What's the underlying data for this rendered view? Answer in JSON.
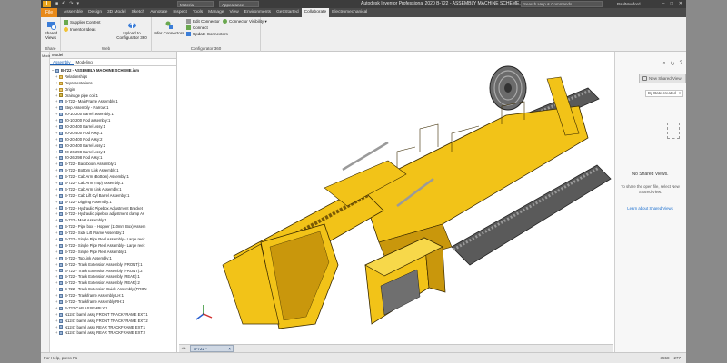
{
  "titlebar": {
    "logo": "I",
    "qat_items": [
      "■",
      "↶",
      "↷",
      "▾"
    ],
    "material": "Material",
    "appearance": "Appearance",
    "title": "Autodesk Inventor Professional 2020   B-722 - ASSEMBLY MACHINE SCHEME.iam",
    "search_placeholder": "Search Help & Commands...",
    "user": "PaulMunford",
    "window_buttons": [
      "−",
      "□",
      "✕"
    ]
  },
  "menubar": {
    "file_label": "File",
    "tabs": [
      {
        "label": "Assemble"
      },
      {
        "label": "Design"
      },
      {
        "label": "3D Model"
      },
      {
        "label": "Sketch"
      },
      {
        "label": "Annotate"
      },
      {
        "label": "Inspect"
      },
      {
        "label": "Tools"
      },
      {
        "label": "Manage"
      },
      {
        "label": "View"
      },
      {
        "label": "Environments"
      },
      {
        "label": "Get Started"
      },
      {
        "label": "Collaborate"
      },
      {
        "label": "Electromechanical"
      }
    ]
  },
  "ribbon": {
    "shared_views": "Shared Views",
    "share_group": "Share",
    "supplier_content": "Supplier Content",
    "inventor_ideas": "Inventor Ideas",
    "web_group": "Web",
    "upload": "Upload to Configurator 360",
    "infer_connectors": "Infer Connectors",
    "edit_connector": "Edit Connector",
    "connect": "Connect",
    "update_connectors": "Update Connectors",
    "connector_visibility": "Connector Visibility",
    "configurator_group": "Configurator 360"
  },
  "browser": {
    "header": "Model",
    "tabs": [
      "Assembly",
      "Modeling"
    ],
    "nodes": [
      {
        "label": "B-722 - ASSEMBLY MACHINE SCHEME.iam",
        "type": "asm"
      },
      {
        "label": "Relationships",
        "type": "folder"
      },
      {
        "label": "Representations",
        "type": "folder"
      },
      {
        "label": "Origin",
        "type": "folder"
      },
      {
        "label": "Drainage pipe coil:1",
        "type": "part"
      },
      {
        "label": "B-722 - MainFrame Assembly:1",
        "type": "asm"
      },
      {
        "label": "Step Assembly - Narrow:1",
        "type": "asm"
      },
      {
        "label": "20-10-200 Barrel assembly:1",
        "type": "asm"
      },
      {
        "label": "20-10-200 Rod assembly:1",
        "type": "asm"
      },
      {
        "label": "20-20-400 Barrel Assy:1",
        "type": "asm"
      },
      {
        "label": "20-20-400 Rod Assy:1",
        "type": "asm"
      },
      {
        "label": "20-20-400 Rod Assy:2",
        "type": "asm"
      },
      {
        "label": "20-20-400 Barrel Assy:2",
        "type": "asm"
      },
      {
        "label": "20-26-298 Barrel Assy:1",
        "type": "asm"
      },
      {
        "label": "20-26-298 Rod Assy:1",
        "type": "asm"
      },
      {
        "label": "B-722 - Backboom Assembly:1",
        "type": "asm"
      },
      {
        "label": "B-722 - Bottom Link Assembly:1",
        "type": "asm"
      },
      {
        "label": "B-722 - Cab Arm (Bottom) Assembly:1",
        "type": "asm"
      },
      {
        "label": "B-722 - Cab Arm (Top) Assembly:1",
        "type": "asm"
      },
      {
        "label": "B-722 - Cab Arm Link Assembly:1",
        "type": "asm"
      },
      {
        "label": "B-722 - Cab Lift Cyl Barrel Assembly:1",
        "type": "asm"
      },
      {
        "label": "B-722 - Digging Assembly:1",
        "type": "asm"
      },
      {
        "label": "B-722 - Hydraulic Pipebox Adjustment Bracket",
        "type": "asm"
      },
      {
        "label": "B-722 - Hydraulic pipebox adjustment clamp As",
        "type": "asm"
      },
      {
        "label": "B-722 - Mast Assembly:1",
        "type": "asm"
      },
      {
        "label": "B-722 - Pipe box + Hopper (110mm Box) Assem",
        "type": "asm"
      },
      {
        "label": "B-722 - Side Lift Frame Assembly:1",
        "type": "asm"
      },
      {
        "label": "B-722 - Single Pipe Reel Assembly - Large reel:",
        "type": "asm"
      },
      {
        "label": "B-722 - Single Pipe Reel Assembly - Large reel:",
        "type": "asm"
      },
      {
        "label": "B-722 - Single Pipe Reel Assembly:1",
        "type": "asm"
      },
      {
        "label": "B-722 - TopLink Assembly:1",
        "type": "asm"
      },
      {
        "label": "B-722 - Track Extension Assembly (FRONT):1",
        "type": "asm"
      },
      {
        "label": "B-722 - Track Extension Assembly (FRONT):2",
        "type": "asm"
      },
      {
        "label": "B-722 - Track Extension Assembly (REAR):1",
        "type": "asm"
      },
      {
        "label": "B-722 - Track Extension Assembly (REAR):2",
        "type": "asm"
      },
      {
        "label": "B-722 - Track Extension Guide Assembly (FRON",
        "type": "asm"
      },
      {
        "label": "B-722 - Trackframe Assembly LH:1",
        "type": "asm"
      },
      {
        "label": "B-722 - Trackframe Assembly RH:1",
        "type": "asm"
      },
      {
        "label": "B-722 CAB ASSEMBLY:1",
        "type": "asm"
      },
      {
        "label": "N1247 barrel assy FRONT TRACKFRAME EXT:1",
        "type": "asm"
      },
      {
        "label": "N1247 barrel assy FRONT TRACKFRAME EXT:2",
        "type": "asm"
      },
      {
        "label": "N1247 barrel assy REAR TRACKFRAME EXT:1",
        "type": "asm"
      },
      {
        "label": "N1247 barrel assy REAR TRACKFRAME EXT:2",
        "type": "asm"
      }
    ]
  },
  "viewport": {
    "tab_label": "B-722 - ASSEMB...iam",
    "tab_close": "×",
    "nav_arrows": "◂ ▸",
    "colors": {
      "body": "#f2c318",
      "shade": "#c9970c",
      "dark": "#7a5a05",
      "track": "#4a4a4a",
      "line": "#3a2a00"
    }
  },
  "shared_panel": {
    "new_view": "New Shared View",
    "sort": "By Date created",
    "sort_arrow": "▾",
    "empty_title": "No Shared Views.",
    "hint": "To share the open file, select New Shared View.",
    "learn": "Learn about Shared Views",
    "toolbar_icons": [
      "search-icon",
      "refresh-icon",
      "help-icon"
    ],
    "toolbar_glyphs": [
      "⌕",
      "↻",
      "?"
    ]
  },
  "statusbar": {
    "help": "For Help, press F1",
    "count1": "3558",
    "count2": "277"
  }
}
